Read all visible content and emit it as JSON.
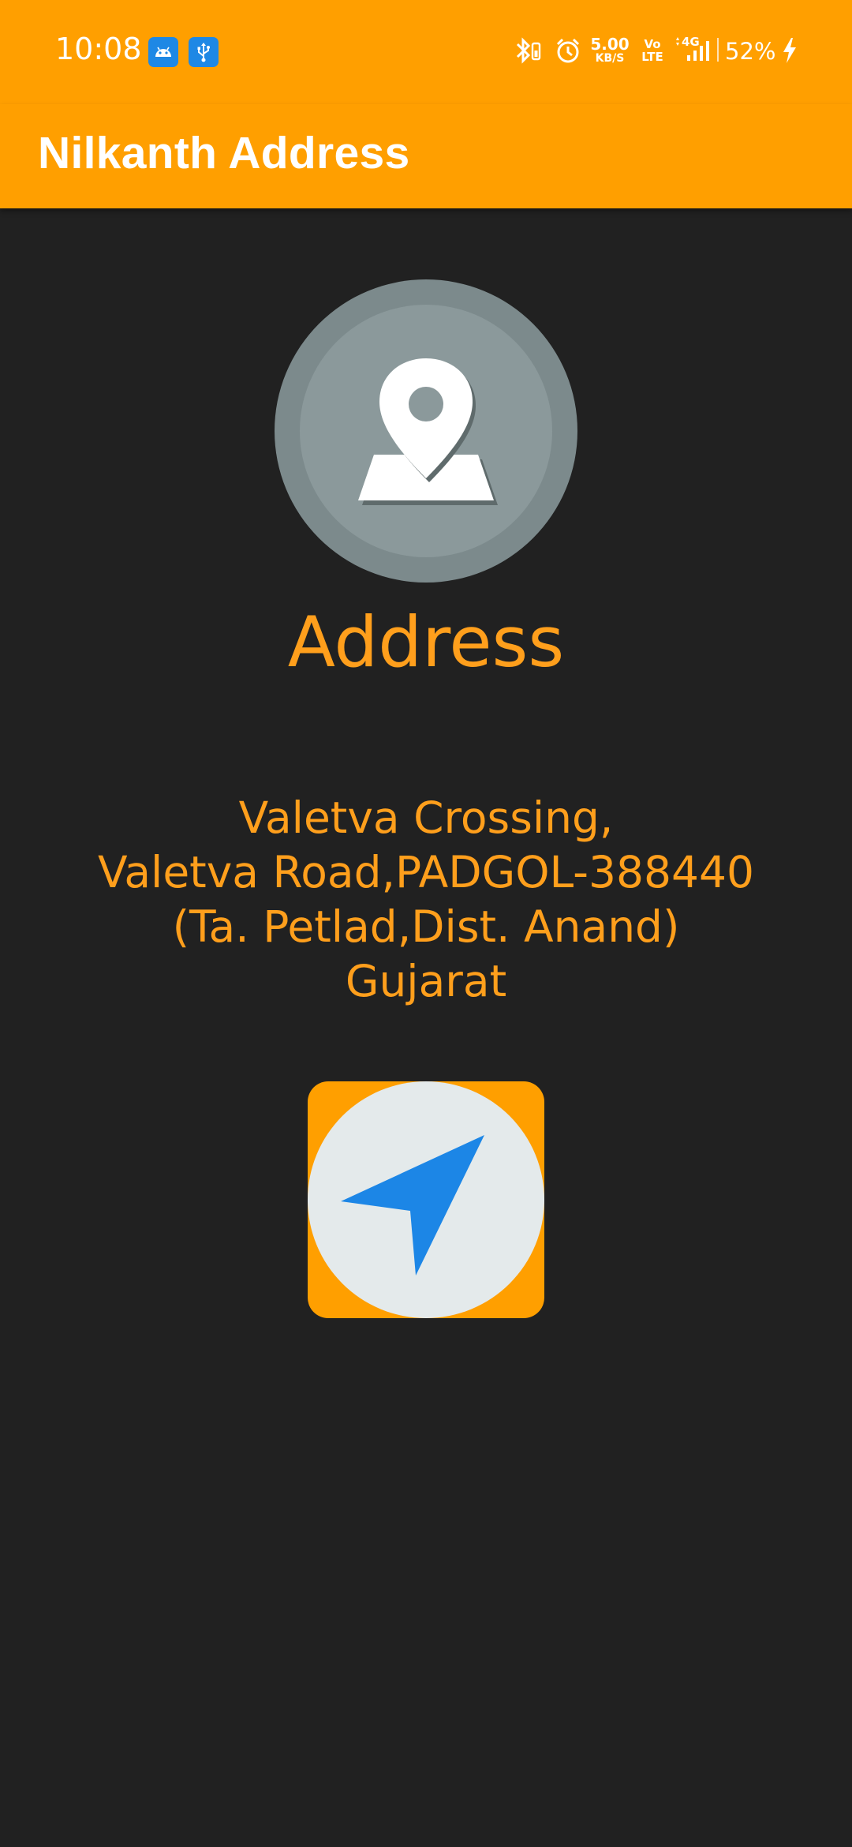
{
  "status_bar": {
    "time": "10:08",
    "notification_icons": [
      "android-icon",
      "usb-icon"
    ],
    "status_icons": [
      "bluetooth-icon",
      "alarm-icon",
      "volte-icon",
      "4g-signal-icon",
      "battery-charging-icon"
    ],
    "net_speed_value": "5.00",
    "net_speed_unit": "KB/S",
    "volte_top": "Vo",
    "volte_bottom": "LTE",
    "network_label": "4G",
    "battery_percent": "52%"
  },
  "app_bar": {
    "title": "Nilkanth Address"
  },
  "main": {
    "icon": "map-location-pin-icon",
    "heading": "Address",
    "address_lines": [
      "Valetva Crossing,",
      "Valetva Road,PADGOL-388440",
      "(Ta. Petlad,Dist. Anand)",
      "Gujarat"
    ],
    "navigate_icon": "navigation-arrow-icon"
  },
  "colors": {
    "accent": "#FF9F00",
    "text_accent": "#FF9F1C",
    "background": "#212121",
    "status_icon_blue": "#1E88E5",
    "navigation_arrow": "#1C86E6",
    "avatar_gray": "#8B999B"
  }
}
